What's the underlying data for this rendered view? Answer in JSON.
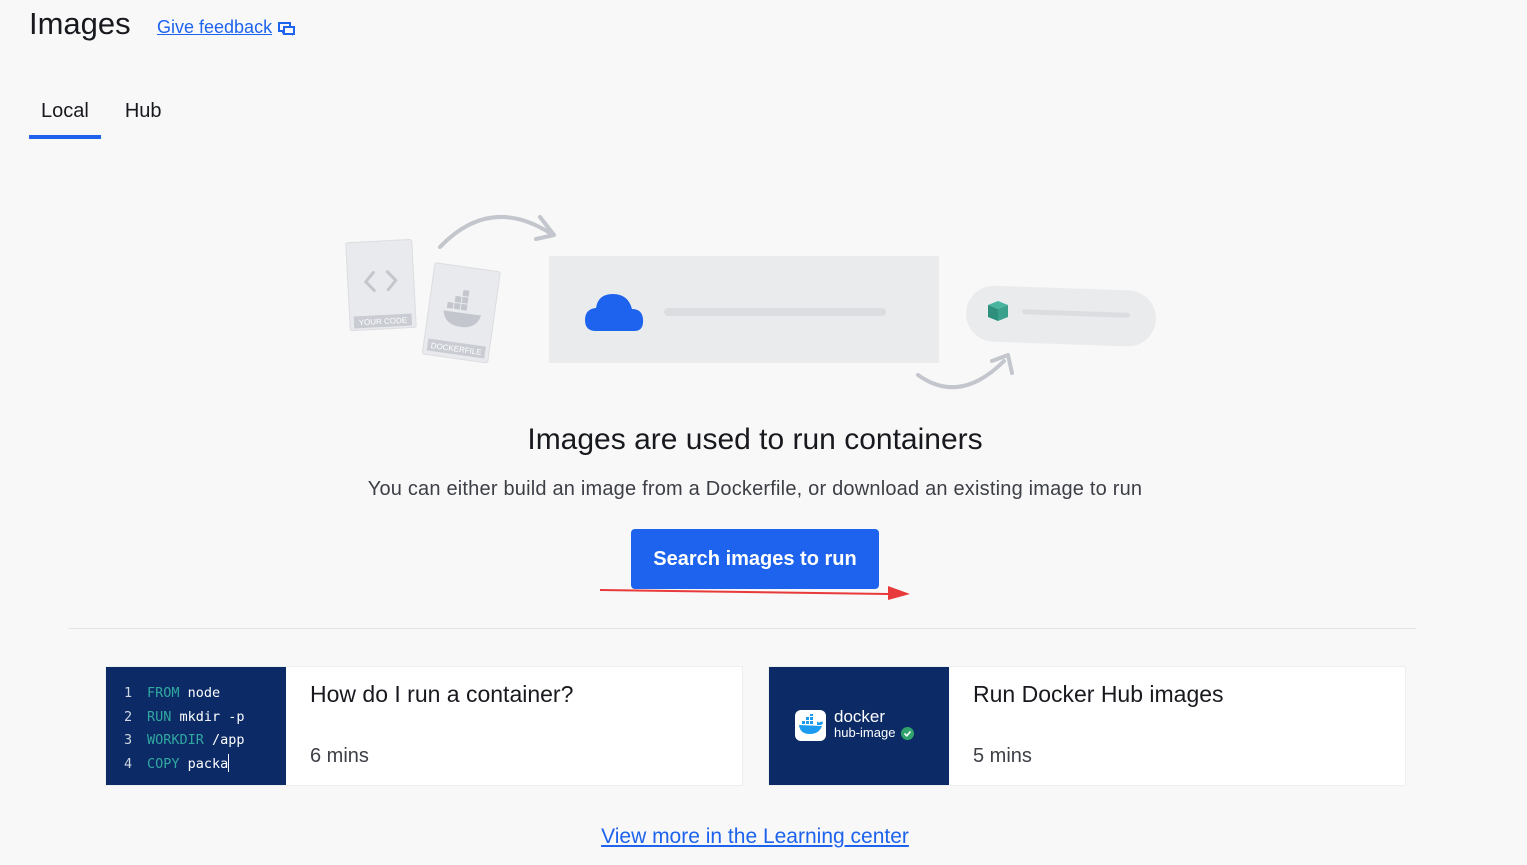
{
  "header": {
    "title": "Images",
    "feedback_label": "Give feedback"
  },
  "tabs": [
    {
      "label": "Local",
      "active": true
    },
    {
      "label": "Hub",
      "active": false
    }
  ],
  "illustration": {
    "your_code_label": "YOUR CODE",
    "dockerfile_label": "DOCKERFILE"
  },
  "empty_state": {
    "heading": "Images are used to run containers",
    "subtext": "You can either build an image from a Dockerfile, or download an existing image to run",
    "button_label": "Search images to run"
  },
  "cards": [
    {
      "title": "How do I run a container?",
      "duration": "6 mins",
      "code_lines": [
        {
          "num": "1",
          "keyword": "FROM",
          "rest": " node"
        },
        {
          "num": "2",
          "keyword": "RUN",
          "rest": " mkdir -p"
        },
        {
          "num": "3",
          "keyword": "WORKDIR",
          "rest": " /app"
        },
        {
          "num": "4",
          "keyword": "COPY",
          "rest": " packa"
        }
      ]
    },
    {
      "title": "Run Docker Hub images",
      "duration": "5 mins",
      "logo_text": "docker",
      "logo_subtext": "hub-image"
    }
  ],
  "learning_center_link": "View more in the Learning center",
  "colors": {
    "accent": "#1d63ed",
    "card_thumb_bg": "#0b2a66",
    "annotation_arrow": "#e83a3a"
  }
}
